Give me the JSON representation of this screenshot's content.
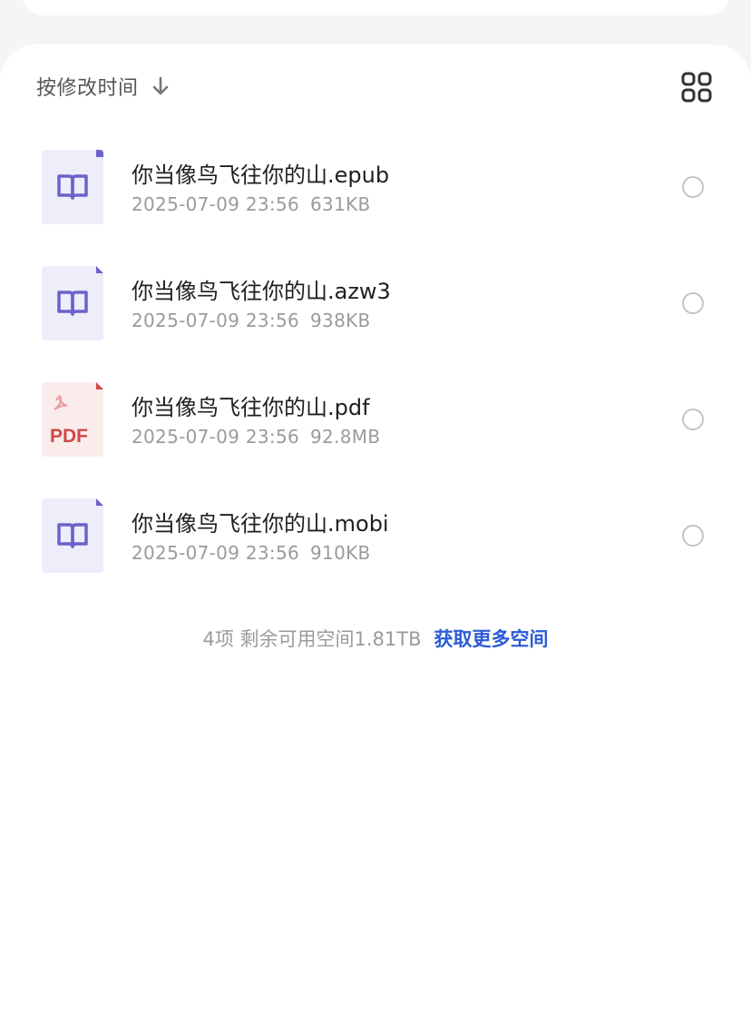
{
  "sort": {
    "label": "按修改时间",
    "arrow_icon": "arrow-down-icon"
  },
  "view_toggle": {
    "icon": "grid-view-icon"
  },
  "files": [
    {
      "name": "你当像鸟飞往你的山.epub",
      "datetime": "2025-07-09 23:56",
      "size": "631KB",
      "icon": "ebook-icon"
    },
    {
      "name": "你当像鸟飞往你的山.azw3",
      "datetime": "2025-07-09 23:56",
      "size": "938KB",
      "icon": "ebook-icon"
    },
    {
      "name": "你当像鸟飞往你的山.pdf",
      "datetime": "2025-07-09 23:56",
      "size": "92.8MB",
      "icon": "pdf-file-icon",
      "badge": "PDF"
    },
    {
      "name": "你当像鸟飞往你的山.mobi",
      "datetime": "2025-07-09 23:56",
      "size": "910KB",
      "icon": "ebook-icon"
    }
  ],
  "footer": {
    "summary": "4项 剩余可用空间1.81TB",
    "link": "获取更多空间"
  },
  "colors": {
    "accent": "#2b5bd7",
    "ebook_icon": "#6b63c9",
    "pdf_icon": "#d04747"
  }
}
